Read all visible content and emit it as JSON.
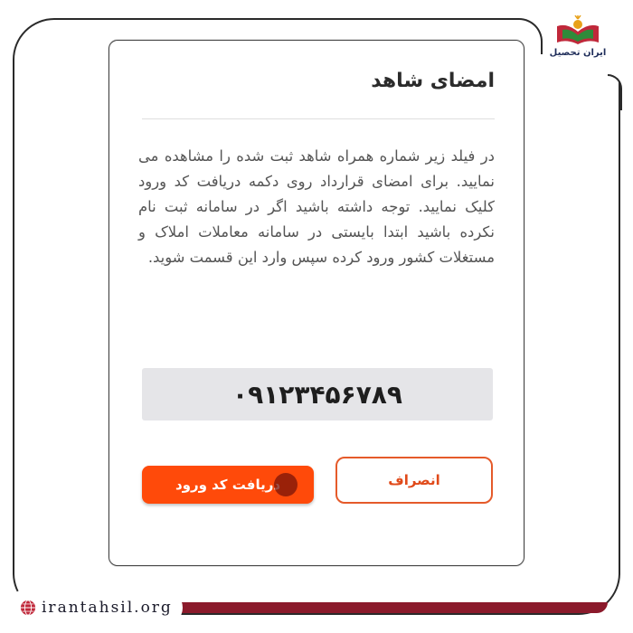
{
  "brand": {
    "logo_text": "ایران تحصیل",
    "website": "irantahsil.org",
    "colors": {
      "accent": "#ff4a0a",
      "dark_red": "#8b1a2b",
      "navy": "#1f2d5a"
    }
  },
  "dialog": {
    "title": "امضای شاهد",
    "body": "در فیلد زیر شماره همراه شاهد ثبت شده را مشاهده می نمایید. برای امضای قرارداد روی دکمه دریافت کد ورود کلیک نمایید. توجه داشته باشید اگر در سامانه ثبت نام نکرده باشید ابتدا بایستی در سامانه معاملات املاک و مستغلات کشور ورود کرده سپس وارد این قسمت شوید.",
    "phone_value": "۰۹۱۲۳۴۵۶۷۸۹",
    "buttons": {
      "cancel_label": "انصراف",
      "get_code_label": "دریافت کد ورود"
    }
  },
  "icons": [
    "logo-book-icon",
    "globe-icon"
  ]
}
